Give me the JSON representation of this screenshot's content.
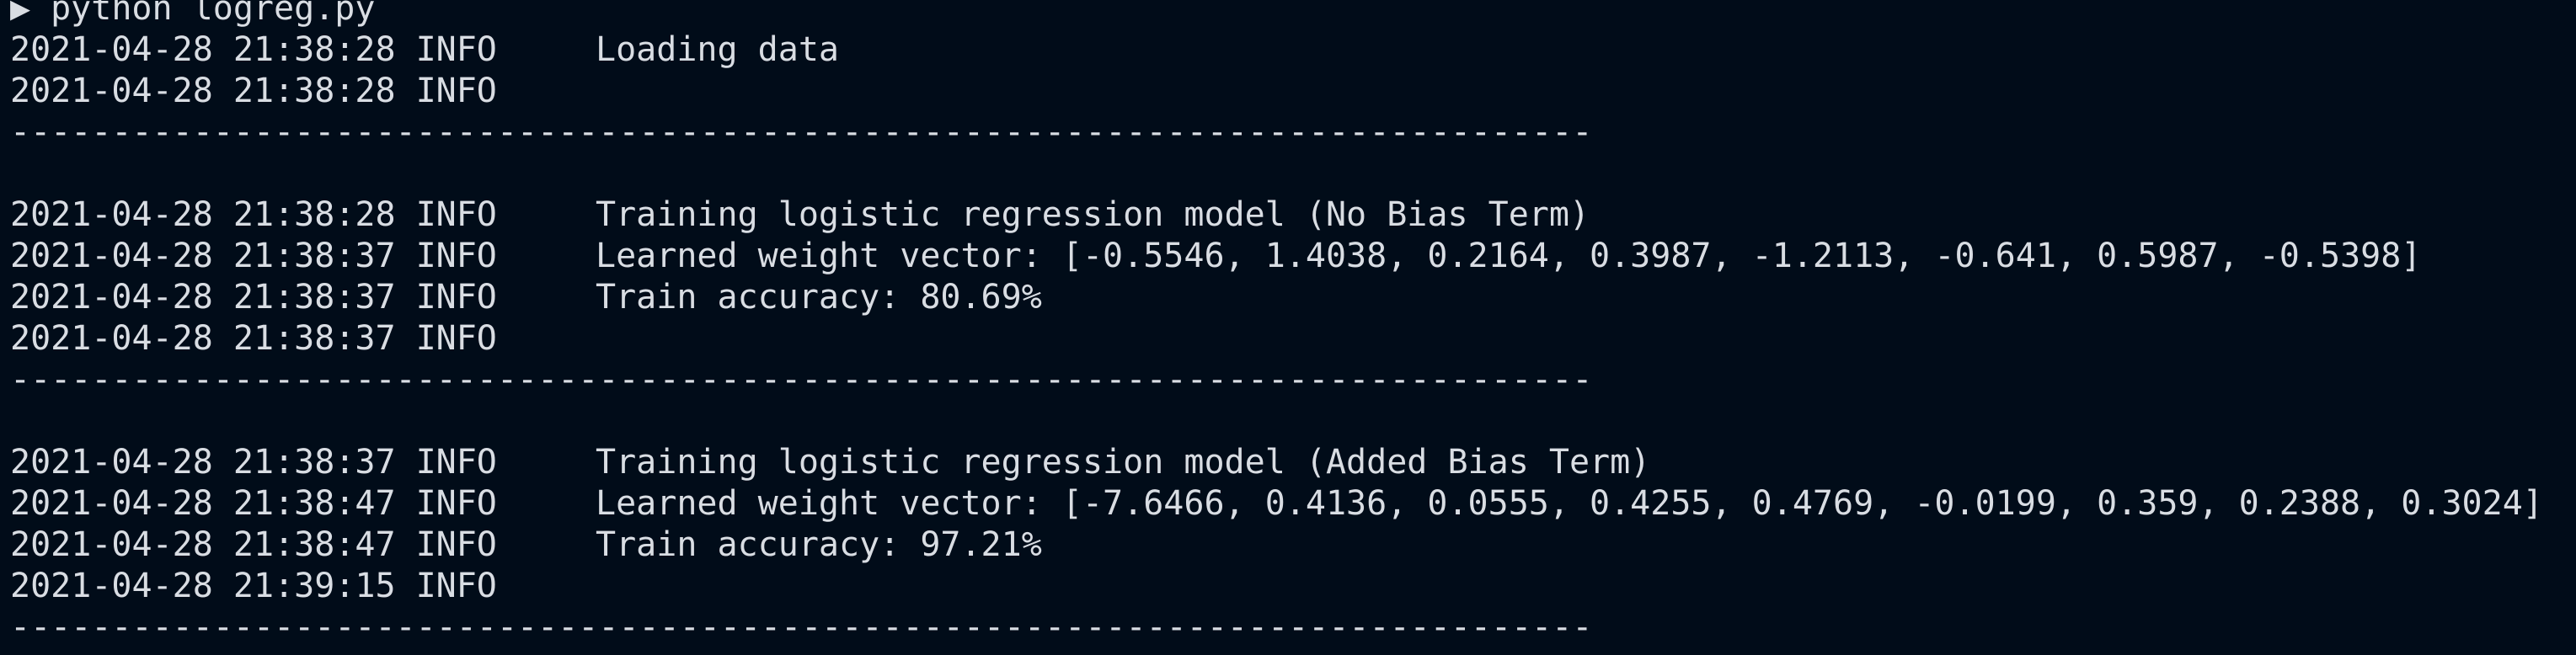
{
  "prompt": {
    "symbol": "▶",
    "command": "python logreg.py"
  },
  "separator": "------------------------------------------------------------------------------",
  "log": [
    {
      "type": "entry",
      "date": "2021-04-28 21:38:28",
      "level": "INFO",
      "message": "Loading data"
    },
    {
      "type": "entry",
      "date": "2021-04-28 21:38:28",
      "level": "INFO",
      "message": ""
    },
    {
      "type": "separator"
    },
    {
      "type": "blank"
    },
    {
      "type": "entry",
      "date": "2021-04-28 21:38:28",
      "level": "INFO",
      "message": "Training logistic regression model (No Bias Term)"
    },
    {
      "type": "entry",
      "date": "2021-04-28 21:38:37",
      "level": "INFO",
      "message": "Learned weight vector: [-0.5546, 1.4038, 0.2164, 0.3987, -1.2113, -0.641, 0.5987, -0.5398]"
    },
    {
      "type": "entry",
      "date": "2021-04-28 21:38:37",
      "level": "INFO",
      "message": "Train accuracy: 80.69%"
    },
    {
      "type": "entry",
      "date": "2021-04-28 21:38:37",
      "level": "INFO",
      "message": ""
    },
    {
      "type": "separator"
    },
    {
      "type": "blank"
    },
    {
      "type": "entry",
      "date": "2021-04-28 21:38:37",
      "level": "INFO",
      "message": "Training logistic regression model (Added Bias Term)"
    },
    {
      "type": "entry",
      "date": "2021-04-28 21:38:47",
      "level": "INFO",
      "message": "Learned weight vector: [-7.6466, 0.4136, 0.0555, 0.4255, 0.4769, -0.0199, 0.359, 0.2388, 0.3024]"
    },
    {
      "type": "entry",
      "date": "2021-04-28 21:38:47",
      "level": "INFO",
      "message": "Train accuracy: 97.21%"
    },
    {
      "type": "entry",
      "date": "2021-04-28 21:39:15",
      "level": "INFO",
      "message": ""
    },
    {
      "type": "separator"
    }
  ]
}
